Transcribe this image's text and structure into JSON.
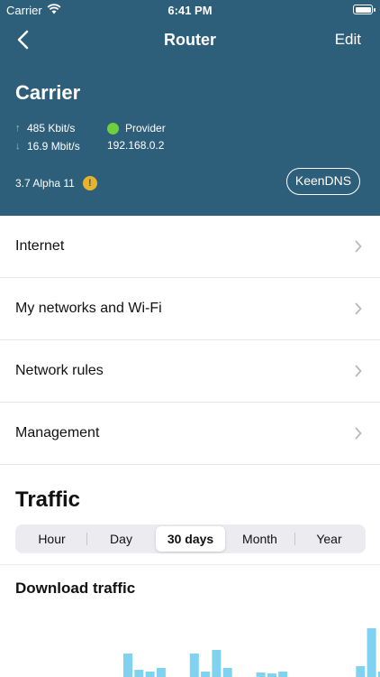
{
  "status_bar": {
    "carrier": "Carrier",
    "time": "6:41 PM"
  },
  "nav": {
    "title": "Router",
    "edit_label": "Edit"
  },
  "device": {
    "name": "Carrier",
    "upload_speed": "485 Kbit/s",
    "download_speed": "16.9 Mbit/s",
    "provider": "Provider",
    "ip": "192.168.0.2",
    "firmware": "3.7 Alpha 11",
    "warning_symbol": "!",
    "keendns_label": "KeenDNS",
    "provider_status_color": "#6fcf3c"
  },
  "menu": [
    {
      "label": "Internet"
    },
    {
      "label": "My networks and Wi-Fi"
    },
    {
      "label": "Network rules"
    },
    {
      "label": "Management"
    }
  ],
  "traffic": {
    "title": "Traffic",
    "periods": [
      "Hour",
      "Day",
      "30 days",
      "Month",
      "Year"
    ],
    "selected_period": "30 days",
    "download_title": "Download traffic"
  },
  "colors": {
    "header_bg": "#2e5f7a",
    "bar_color": "#7fd3f0"
  },
  "chart_data": {
    "type": "bar",
    "title": "Download traffic",
    "values": [
      0,
      0,
      0,
      0,
      0,
      0,
      0,
      0,
      0,
      0,
      26,
      8,
      6,
      10,
      0,
      0,
      26,
      6,
      30,
      10,
      0,
      0,
      5,
      4,
      6,
      0,
      0,
      0,
      0,
      0,
      0,
      12,
      54,
      6,
      0,
      0
    ],
    "ylim": [
      0,
      80
    ]
  }
}
